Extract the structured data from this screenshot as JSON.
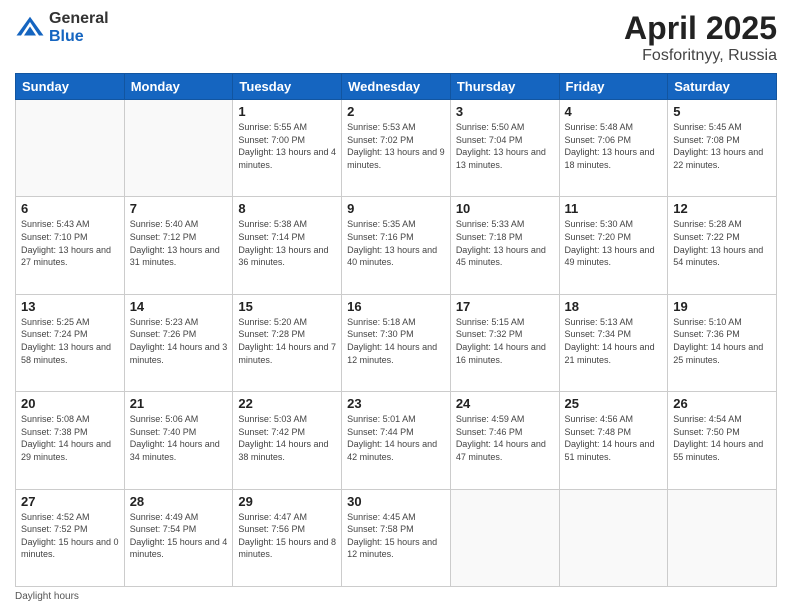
{
  "header": {
    "logo_general": "General",
    "logo_blue": "Blue",
    "title": "April 2025",
    "location": "Fosforitnyy, Russia"
  },
  "days_of_week": [
    "Sunday",
    "Monday",
    "Tuesday",
    "Wednesday",
    "Thursday",
    "Friday",
    "Saturday"
  ],
  "weeks": [
    [
      {
        "day": "",
        "info": ""
      },
      {
        "day": "",
        "info": ""
      },
      {
        "day": "1",
        "info": "Sunrise: 5:55 AM\nSunset: 7:00 PM\nDaylight: 13 hours and 4 minutes."
      },
      {
        "day": "2",
        "info": "Sunrise: 5:53 AM\nSunset: 7:02 PM\nDaylight: 13 hours and 9 minutes."
      },
      {
        "day": "3",
        "info": "Sunrise: 5:50 AM\nSunset: 7:04 PM\nDaylight: 13 hours and 13 minutes."
      },
      {
        "day": "4",
        "info": "Sunrise: 5:48 AM\nSunset: 7:06 PM\nDaylight: 13 hours and 18 minutes."
      },
      {
        "day": "5",
        "info": "Sunrise: 5:45 AM\nSunset: 7:08 PM\nDaylight: 13 hours and 22 minutes."
      }
    ],
    [
      {
        "day": "6",
        "info": "Sunrise: 5:43 AM\nSunset: 7:10 PM\nDaylight: 13 hours and 27 minutes."
      },
      {
        "day": "7",
        "info": "Sunrise: 5:40 AM\nSunset: 7:12 PM\nDaylight: 13 hours and 31 minutes."
      },
      {
        "day": "8",
        "info": "Sunrise: 5:38 AM\nSunset: 7:14 PM\nDaylight: 13 hours and 36 minutes."
      },
      {
        "day": "9",
        "info": "Sunrise: 5:35 AM\nSunset: 7:16 PM\nDaylight: 13 hours and 40 minutes."
      },
      {
        "day": "10",
        "info": "Sunrise: 5:33 AM\nSunset: 7:18 PM\nDaylight: 13 hours and 45 minutes."
      },
      {
        "day": "11",
        "info": "Sunrise: 5:30 AM\nSunset: 7:20 PM\nDaylight: 13 hours and 49 minutes."
      },
      {
        "day": "12",
        "info": "Sunrise: 5:28 AM\nSunset: 7:22 PM\nDaylight: 13 hours and 54 minutes."
      }
    ],
    [
      {
        "day": "13",
        "info": "Sunrise: 5:25 AM\nSunset: 7:24 PM\nDaylight: 13 hours and 58 minutes."
      },
      {
        "day": "14",
        "info": "Sunrise: 5:23 AM\nSunset: 7:26 PM\nDaylight: 14 hours and 3 minutes."
      },
      {
        "day": "15",
        "info": "Sunrise: 5:20 AM\nSunset: 7:28 PM\nDaylight: 14 hours and 7 minutes."
      },
      {
        "day": "16",
        "info": "Sunrise: 5:18 AM\nSunset: 7:30 PM\nDaylight: 14 hours and 12 minutes."
      },
      {
        "day": "17",
        "info": "Sunrise: 5:15 AM\nSunset: 7:32 PM\nDaylight: 14 hours and 16 minutes."
      },
      {
        "day": "18",
        "info": "Sunrise: 5:13 AM\nSunset: 7:34 PM\nDaylight: 14 hours and 21 minutes."
      },
      {
        "day": "19",
        "info": "Sunrise: 5:10 AM\nSunset: 7:36 PM\nDaylight: 14 hours and 25 minutes."
      }
    ],
    [
      {
        "day": "20",
        "info": "Sunrise: 5:08 AM\nSunset: 7:38 PM\nDaylight: 14 hours and 29 minutes."
      },
      {
        "day": "21",
        "info": "Sunrise: 5:06 AM\nSunset: 7:40 PM\nDaylight: 14 hours and 34 minutes."
      },
      {
        "day": "22",
        "info": "Sunrise: 5:03 AM\nSunset: 7:42 PM\nDaylight: 14 hours and 38 minutes."
      },
      {
        "day": "23",
        "info": "Sunrise: 5:01 AM\nSunset: 7:44 PM\nDaylight: 14 hours and 42 minutes."
      },
      {
        "day": "24",
        "info": "Sunrise: 4:59 AM\nSunset: 7:46 PM\nDaylight: 14 hours and 47 minutes."
      },
      {
        "day": "25",
        "info": "Sunrise: 4:56 AM\nSunset: 7:48 PM\nDaylight: 14 hours and 51 minutes."
      },
      {
        "day": "26",
        "info": "Sunrise: 4:54 AM\nSunset: 7:50 PM\nDaylight: 14 hours and 55 minutes."
      }
    ],
    [
      {
        "day": "27",
        "info": "Sunrise: 4:52 AM\nSunset: 7:52 PM\nDaylight: 15 hours and 0 minutes."
      },
      {
        "day": "28",
        "info": "Sunrise: 4:49 AM\nSunset: 7:54 PM\nDaylight: 15 hours and 4 minutes."
      },
      {
        "day": "29",
        "info": "Sunrise: 4:47 AM\nSunset: 7:56 PM\nDaylight: 15 hours and 8 minutes."
      },
      {
        "day": "30",
        "info": "Sunrise: 4:45 AM\nSunset: 7:58 PM\nDaylight: 15 hours and 12 minutes."
      },
      {
        "day": "",
        "info": ""
      },
      {
        "day": "",
        "info": ""
      },
      {
        "day": "",
        "info": ""
      }
    ]
  ],
  "footer": {
    "daylight_label": "Daylight hours"
  }
}
